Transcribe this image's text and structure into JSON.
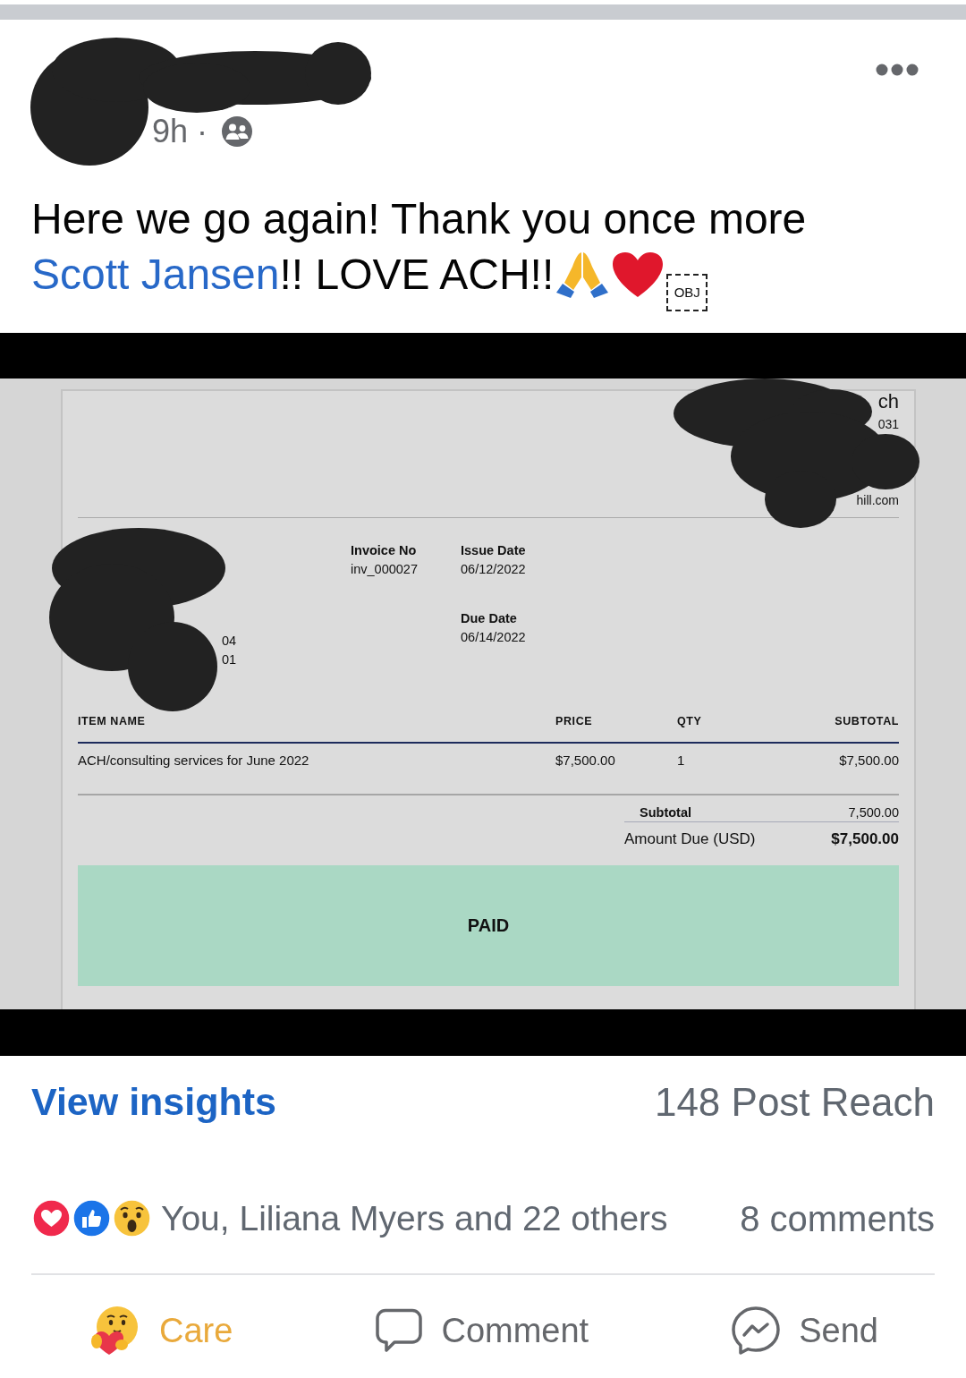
{
  "header": {
    "time": "9h ·"
  },
  "post": {
    "text": "Here we go again! Thank you once more",
    "mention": "Scott Jansen",
    "text_end": "!! LOVE ACH!!",
    "unknown_glyph": "OBJ"
  },
  "invoice": {
    "top_right_lines": [
      "ch",
      "031",
      "hill.com"
    ],
    "left_lines": [
      "04",
      "01"
    ],
    "meta_columns": [
      [
        {
          "label": "Invoice No",
          "value": "inv_000027"
        }
      ],
      [
        {
          "label": "Issue Date",
          "value": "06/12/2022"
        },
        {
          "label": "Due Date",
          "value": "06/14/2022"
        }
      ]
    ],
    "columns": [
      "ITEM NAME",
      "PRICE",
      "QTY",
      "SUBTOTAL"
    ],
    "rows": [
      [
        "ACH/consulting services for June 2022",
        "$7,500.00",
        "1",
        "$7,500.00"
      ]
    ],
    "totals": [
      {
        "kind": "subtotal",
        "label": "Subtotal",
        "value": "7,500.00"
      },
      {
        "kind": "due",
        "label": "Amount Due (USD)",
        "value": "$7,500.00"
      }
    ],
    "status": "PAID"
  },
  "insights": {
    "link": "View insights",
    "reach": "148 Post Reach"
  },
  "reactions": {
    "summary": "You, Liliana Myers and 22 others",
    "comments": "8 comments"
  },
  "actions": [
    {
      "kind": "care",
      "label": "Care",
      "selected": true
    },
    {
      "kind": "comment",
      "label": "Comment",
      "selected": false
    },
    {
      "kind": "send",
      "label": "Send",
      "selected": false
    }
  ]
}
